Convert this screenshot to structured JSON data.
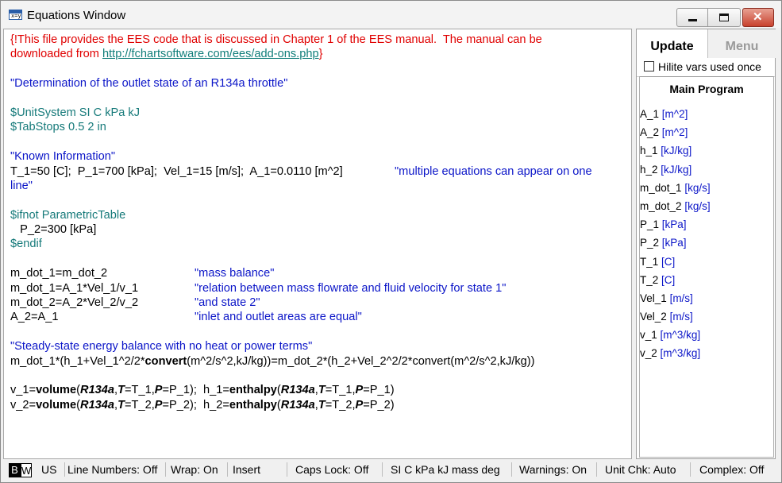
{
  "window": {
    "title": "Equations Window",
    "icon_text": "x=y",
    "icon": "equations-app-icon"
  },
  "title_buttons": {
    "minimize_icon": "minimize-icon",
    "maximize_icon": "maximize-icon",
    "close_icon": "close-icon",
    "close_glyph": "✕"
  },
  "code": {
    "l1": "{!This file provides the EES code that is discussed in Chapter 1 of the EES manual.  The manual can be",
    "l2_pre": "downloaded from ",
    "l2_link": "http://fchartsoftware.com/ees/add-ons.php",
    "l2_post": "}",
    "l4": "\"Determination of the outlet state of an R134a throttle\"",
    "l6": "$UnitSystem SI C kPa kJ",
    "l7": "$TabStops 0.5 2 in",
    "l9": "\"Known Information\"",
    "l10_eq": "T_1=50 [C];  P_1=700 [kPa];  Vel_1=15 [m/s];  A_1=0.0110 [m^2]",
    "l10_com": "\"multiple equations can appear on one",
    "l11": "line\"",
    "l13": "$ifnot ParametricTable",
    "l14": "   P_2=300 [kPa]",
    "l15": "$endif",
    "l17_eq": "m_dot_1=m_dot_2",
    "l17_com": "\"mass balance\"",
    "l18_eq": "m_dot_1=A_1*Vel_1/v_1",
    "l18_com": "\"relation between mass flowrate and fluid velocity for state 1\"",
    "l19_eq": "m_dot_2=A_2*Vel_2/v_2",
    "l19_com": "\"and state 2\"",
    "l20_eq": "A_2=A_1",
    "l20_com": "\"inlet and outlet areas are equal\"",
    "l22": "\"Steady-state energy balance with no heat or power terms\"",
    "l23_a": "m_dot_1*(h_1+Vel_1^2/2*",
    "l23_b": "convert",
    "l23_c": "(m^2/s^2,kJ/kg))=m_dot_2*(h_2+Vel_2^2/2*convert(m^2/s^2,kJ/kg))",
    "l25": {
      "a": "v_1=",
      "fn1": "volume",
      "p1": "(",
      "f1": "R134a",
      "c1": ",",
      "t": "T",
      "e1": "=T_1,",
      "p": "P",
      "e2": "=P_1);  h_1=",
      "fn2": "enthalpy",
      "p2": "(",
      "f2": "R134a",
      "c2": ",",
      "t2": "T",
      "e3": "=T_1,",
      "pp2": "P",
      "e4": "=P_1)"
    },
    "l26": {
      "a": "v_2=",
      "fn1": "volume",
      "p1": "(",
      "f1": "R134a",
      "c1": ",",
      "t": "T",
      "e1": "=T_2,",
      "p": "P",
      "e2": "=P_2);  h_2=",
      "fn2": "enthalpy",
      "p2": "(",
      "f2": "R134a",
      "c2": ",",
      "t2": "T",
      "e3": "=T_2,",
      "pp2": "P",
      "e4": "=P_2)"
    }
  },
  "panel": {
    "tab_update": "Update",
    "tab_menu": "Menu",
    "hilite_label": "Hilite vars used once",
    "section_title": "Main Program",
    "variables": [
      {
        "name": "A_1",
        "unit": "[m^2]"
      },
      {
        "name": "A_2",
        "unit": "[m^2]"
      },
      {
        "name": "h_1",
        "unit": "[kJ/kg]"
      },
      {
        "name": "h_2",
        "unit": "[kJ/kg]"
      },
      {
        "name": "m_dot_1",
        "unit": "[kg/s]"
      },
      {
        "name": "m_dot_2",
        "unit": "[kg/s]"
      },
      {
        "name": "P_1",
        "unit": "[kPa]"
      },
      {
        "name": "P_2",
        "unit": "[kPa]"
      },
      {
        "name": "T_1",
        "unit": "[C]"
      },
      {
        "name": "T_2",
        "unit": "[C]"
      },
      {
        "name": "Vel_1",
        "unit": "[m/s]"
      },
      {
        "name": "Vel_2",
        "unit": "[m/s]"
      },
      {
        "name": "v_1",
        "unit": "[m^3/kg]"
      },
      {
        "name": "v_2",
        "unit": "[m^3/kg]"
      }
    ]
  },
  "status": {
    "bw_b": "B",
    "bw_w": "W",
    "us": "US",
    "line_numbers": "Line Numbers: Off",
    "wrap": "Wrap: On",
    "insert": "Insert",
    "caps": "Caps Lock: Off",
    "units": "SI C kPa kJ mass deg",
    "warnings": "Warnings: On",
    "unitchk": "Unit Chk: Auto",
    "complex": "Complex: Off"
  }
}
